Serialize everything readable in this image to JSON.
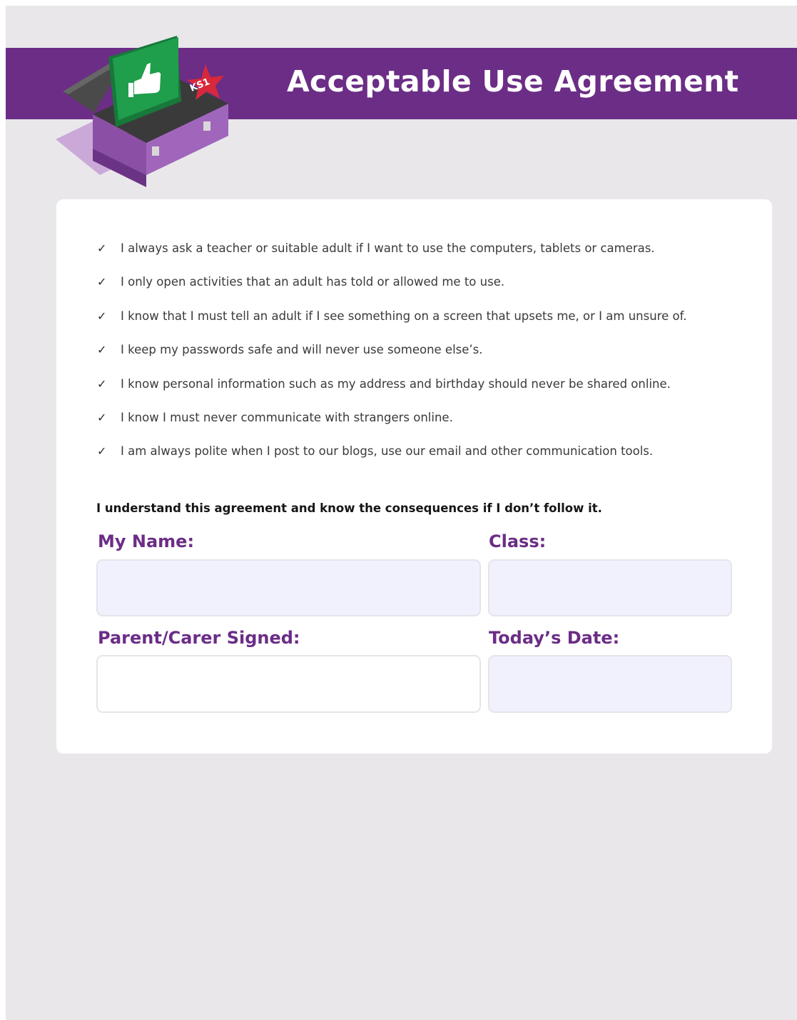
{
  "header": {
    "title": "Acceptable Use Agreement",
    "badge": "KS1",
    "banner_color": "#6b2d86"
  },
  "illustration": {
    "icon": "toolbox-thumbs-up-icon"
  },
  "rules": [
    "I always ask a teacher or suitable adult if I want to use the computers, tablets or cameras.",
    "I only open activities that an adult has told or allowed me to use.",
    "I know that I must tell an adult if I see something on a screen that upsets me, or I am unsure of.",
    "I keep my passwords safe and will never use someone else’s.",
    "I know personal information such as my address and birthday should never be shared online.",
    "I know I must never communicate with strangers online.",
    "I am always polite when I post to our blogs, use our email and other communication tools."
  ],
  "check_glyph": "✓",
  "statement": "I understand this agreement and know the consequences if I don’t follow it.",
  "form": {
    "name_label": "My Name:",
    "name_value": "",
    "class_label": "Class:",
    "class_value": "",
    "parent_label": "Parent/Carer Signed:",
    "parent_value": "",
    "date_label": "Today’s Date:",
    "date_value": ""
  }
}
